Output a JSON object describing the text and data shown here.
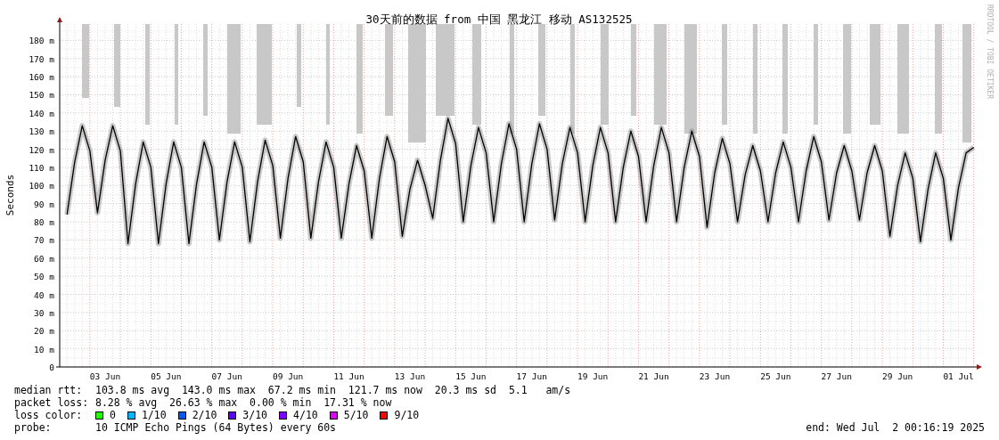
{
  "chart": {
    "credit": "RRDTOOL / TOBI OETIKER",
    "chart_data": {
      "type": "line",
      "title": "30天前的数据 from 中国 黑龙江 移动 AS132525",
      "ylabel": "Seconds",
      "categories": [
        null,
        null,
        null,
        null,
        null,
        "03 Jun",
        null,
        null,
        null,
        null,
        null,
        null,
        null,
        "05 Jun",
        null,
        null,
        null,
        null,
        null,
        null,
        null,
        "07 Jun",
        null,
        null,
        null,
        null,
        null,
        null,
        null,
        "09 Jun",
        null,
        null,
        null,
        null,
        null,
        null,
        null,
        "11 Jun",
        null,
        null,
        null,
        null,
        null,
        null,
        null,
        "13 Jun",
        null,
        null,
        null,
        null,
        null,
        null,
        null,
        "15 Jun",
        null,
        null,
        null,
        null,
        null,
        null,
        null,
        "17 Jun",
        null,
        null,
        null,
        null,
        null,
        null,
        null,
        "19 Jun",
        null,
        null,
        null,
        null,
        null,
        null,
        null,
        "21 Jun",
        null,
        null,
        null,
        null,
        null,
        null,
        null,
        "23 Jun",
        null,
        null,
        null,
        null,
        null,
        null,
        null,
        "25 Jun",
        null,
        null,
        null,
        null,
        null,
        null,
        null,
        "27 Jun",
        null,
        null,
        null,
        null,
        null,
        null,
        null,
        "29 Jun",
        null,
        null,
        null,
        null,
        null,
        null,
        null,
        "01 Jul",
        null,
        null
      ],
      "series": [
        {
          "name": "median rtt:",
          "color": "#000000",
          "values": [
            84,
            113,
            133,
            119,
            85,
            114,
            133,
            119,
            68,
            101,
            124,
            110,
            68,
            101,
            124,
            110,
            68,
            101,
            124,
            110,
            70,
            102,
            124,
            110,
            69,
            102,
            125,
            111,
            71,
            104,
            127,
            113,
            71,
            102,
            124,
            110,
            71,
            101,
            122,
            108,
            71,
            104,
            127,
            113,
            72,
            98,
            114,
            100,
            82,
            114,
            137,
            123,
            80,
            111,
            132,
            118,
            80,
            112,
            134,
            120,
            80,
            112,
            134,
            120,
            81,
            112,
            132,
            118,
            80,
            111,
            132,
            118,
            80,
            110,
            130,
            116,
            80,
            111,
            132,
            118,
            80,
            110,
            130,
            116,
            77,
            107,
            126,
            112,
            80,
            106,
            122,
            108,
            80,
            107,
            124,
            110,
            80,
            108,
            127,
            113,
            81,
            107,
            122,
            108,
            81,
            107,
            122,
            108,
            72,
            100,
            118,
            104,
            69,
            98,
            118,
            104,
            70,
            99,
            118,
            121
          ]
        }
      ],
      "ylim": [
        0,
        189
      ],
      "grid": true,
      "yticks": [
        {
          "value": 0,
          "label": "0"
        },
        {
          "value": 10,
          "label": "10 m"
        },
        {
          "value": 20,
          "label": "20 m"
        },
        {
          "value": 30,
          "label": "30 m"
        },
        {
          "value": 40,
          "label": "40 m"
        },
        {
          "value": 50,
          "label": "50 m"
        },
        {
          "value": 60,
          "label": "60 m"
        },
        {
          "value": 70,
          "label": "70 m"
        },
        {
          "value": 80,
          "label": "80 m"
        },
        {
          "value": 90,
          "label": "90 m"
        },
        {
          "value": 100,
          "label": "100 m"
        },
        {
          "value": 110,
          "label": "110 m"
        },
        {
          "value": 120,
          "label": "120 m"
        },
        {
          "value": 130,
          "label": "130 m"
        },
        {
          "value": 140,
          "label": "140 m"
        },
        {
          "value": 150,
          "label": "150 m"
        },
        {
          "value": 160,
          "label": "160 m"
        },
        {
          "value": 170,
          "label": "170 m"
        },
        {
          "value": 180,
          "label": "180 m"
        }
      ]
    }
  },
  "legend": {
    "median_rtt": {
      "text": "103.8 ms avg  143.0 ms max  67.2 ms min  121.7 ms now  20.3 ms sd  5.1   am/s"
    },
    "packet_loss": {
      "label": "packet loss:",
      "text": "8.28 % avg  26.63 % max  0.00 % min  17.31 % now"
    },
    "loss_color": {
      "label": "loss color:",
      "items": [
        {
          "label": "0",
          "color": "#26ff00"
        },
        {
          "label": "1/10",
          "color": "#00b8ff"
        },
        {
          "label": "2/10",
          "color": "#0059ff"
        },
        {
          "label": "3/10",
          "color": "#5e00ff"
        },
        {
          "label": "4/10",
          "color": "#7e00ff"
        },
        {
          "label": "5/10",
          "color": "#dd00ff"
        },
        {
          "label": "9/10",
          "color": "#ff0000"
        }
      ]
    },
    "probe": {
      "label": "probe:",
      "text": "10 ICMP Echo Pings (64 Bytes) every 60s"
    },
    "end": "end: Wed Jul  2 00:16:19 2025"
  }
}
